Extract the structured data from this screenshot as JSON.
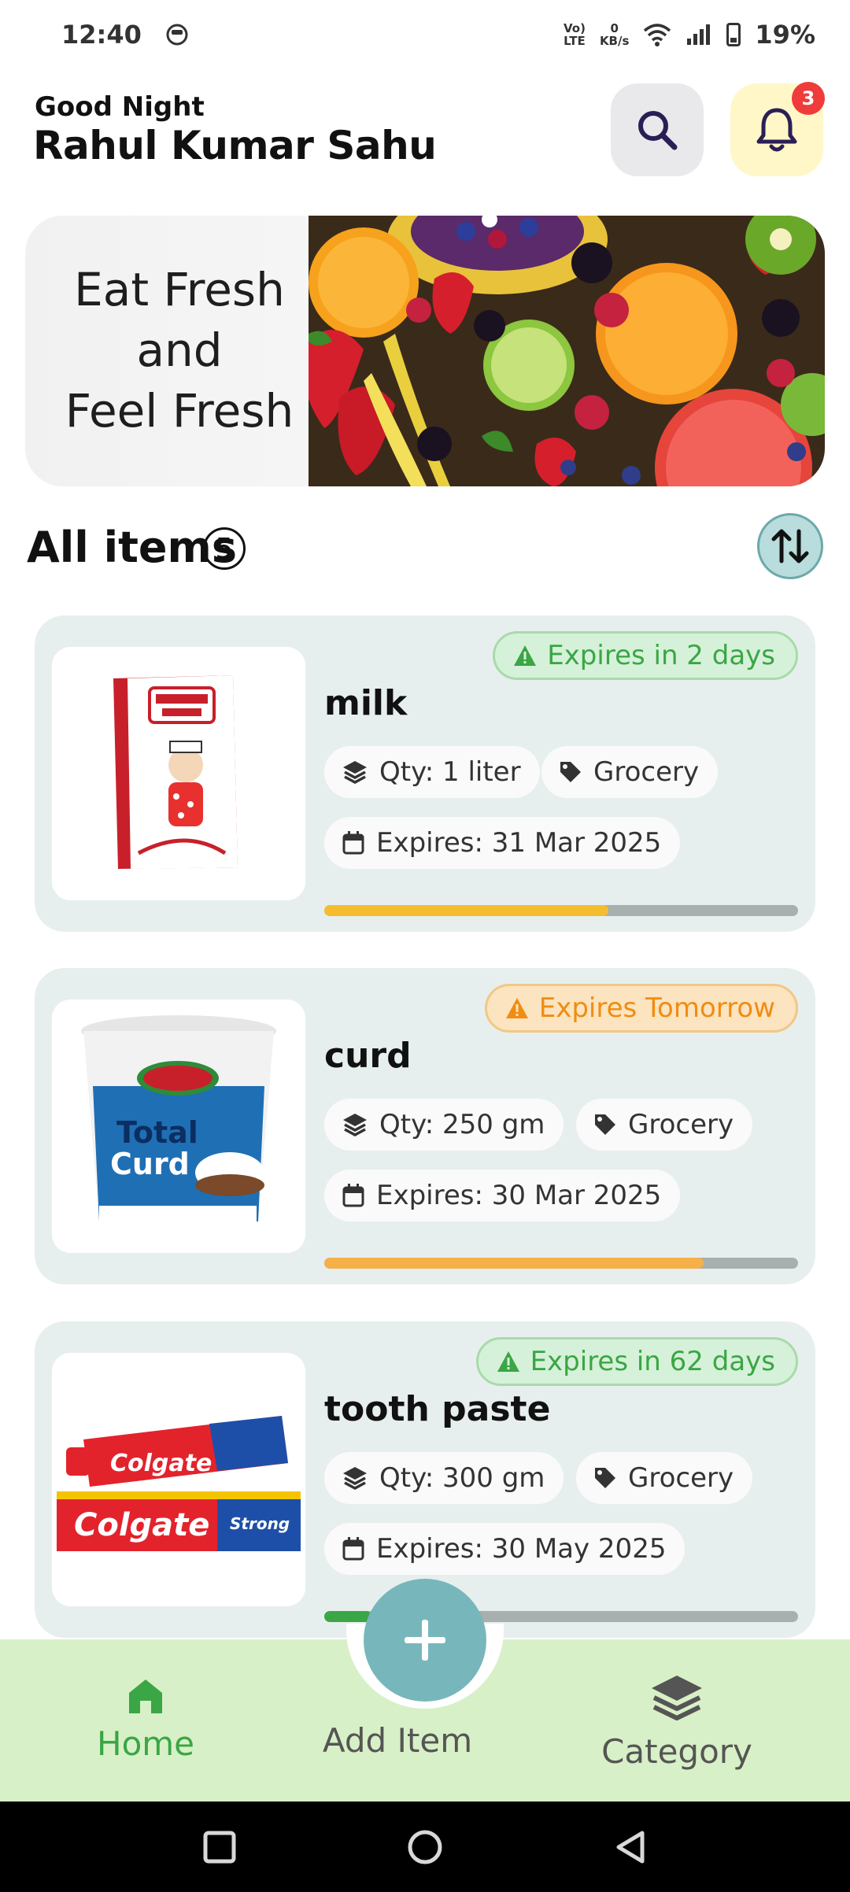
{
  "status_bar": {
    "time": "12:40",
    "network_type_top": "Vo)",
    "network_type_bottom": "LTE",
    "speed_value": "0",
    "speed_unit": "KB/s",
    "battery_percent": "19%"
  },
  "header": {
    "greeting": "Good Night",
    "user_name": "Rahul Kumar Sahu",
    "notification_count": "3"
  },
  "banner": {
    "line1": "Eat Fresh",
    "line2": "and",
    "line3": "Feel Fresh"
  },
  "list": {
    "title": "All items",
    "count": "5"
  },
  "items": [
    {
      "name": "milk",
      "expiry_status": "Expires in 2 days",
      "qty": "Qty: 1 liter",
      "category": "Grocery",
      "expires": "Expires: 31 Mar 2025",
      "progress": 0.6,
      "progress_color": "#f5bd2d"
    },
    {
      "name": "curd",
      "expiry_status": "Expires Tomorrow",
      "qty": "Qty: 250 gm",
      "category": "Grocery",
      "expires": "Expires: 30 Mar 2025",
      "progress": 0.8,
      "progress_color": "#f5b04a"
    },
    {
      "name": "tooth paste",
      "expiry_status": "Expires in 62 days",
      "qty": "Qty: 300 gm",
      "category": "Grocery",
      "expires": "Expires: 30 May 2025",
      "progress": 0.1,
      "progress_color": "#3aa645"
    }
  ],
  "bottom_nav": {
    "home": "Home",
    "add_item": "Add Item",
    "category": "Category"
  },
  "colors": {
    "accent_green": "#3aa645",
    "accent_orange": "#f08c12",
    "nav_background": "#d8f0c7",
    "fab": "#77b7bb"
  },
  "icons": [
    "face-icon",
    "wifi-icon",
    "signal-icon",
    "battery-icon",
    "search-icon",
    "bell-icon",
    "sort-icon",
    "warning-icon",
    "layers-icon",
    "tag-icon",
    "calendar-icon",
    "home-icon",
    "plus-icon",
    "square-icon",
    "circle-icon",
    "back-icon"
  ]
}
